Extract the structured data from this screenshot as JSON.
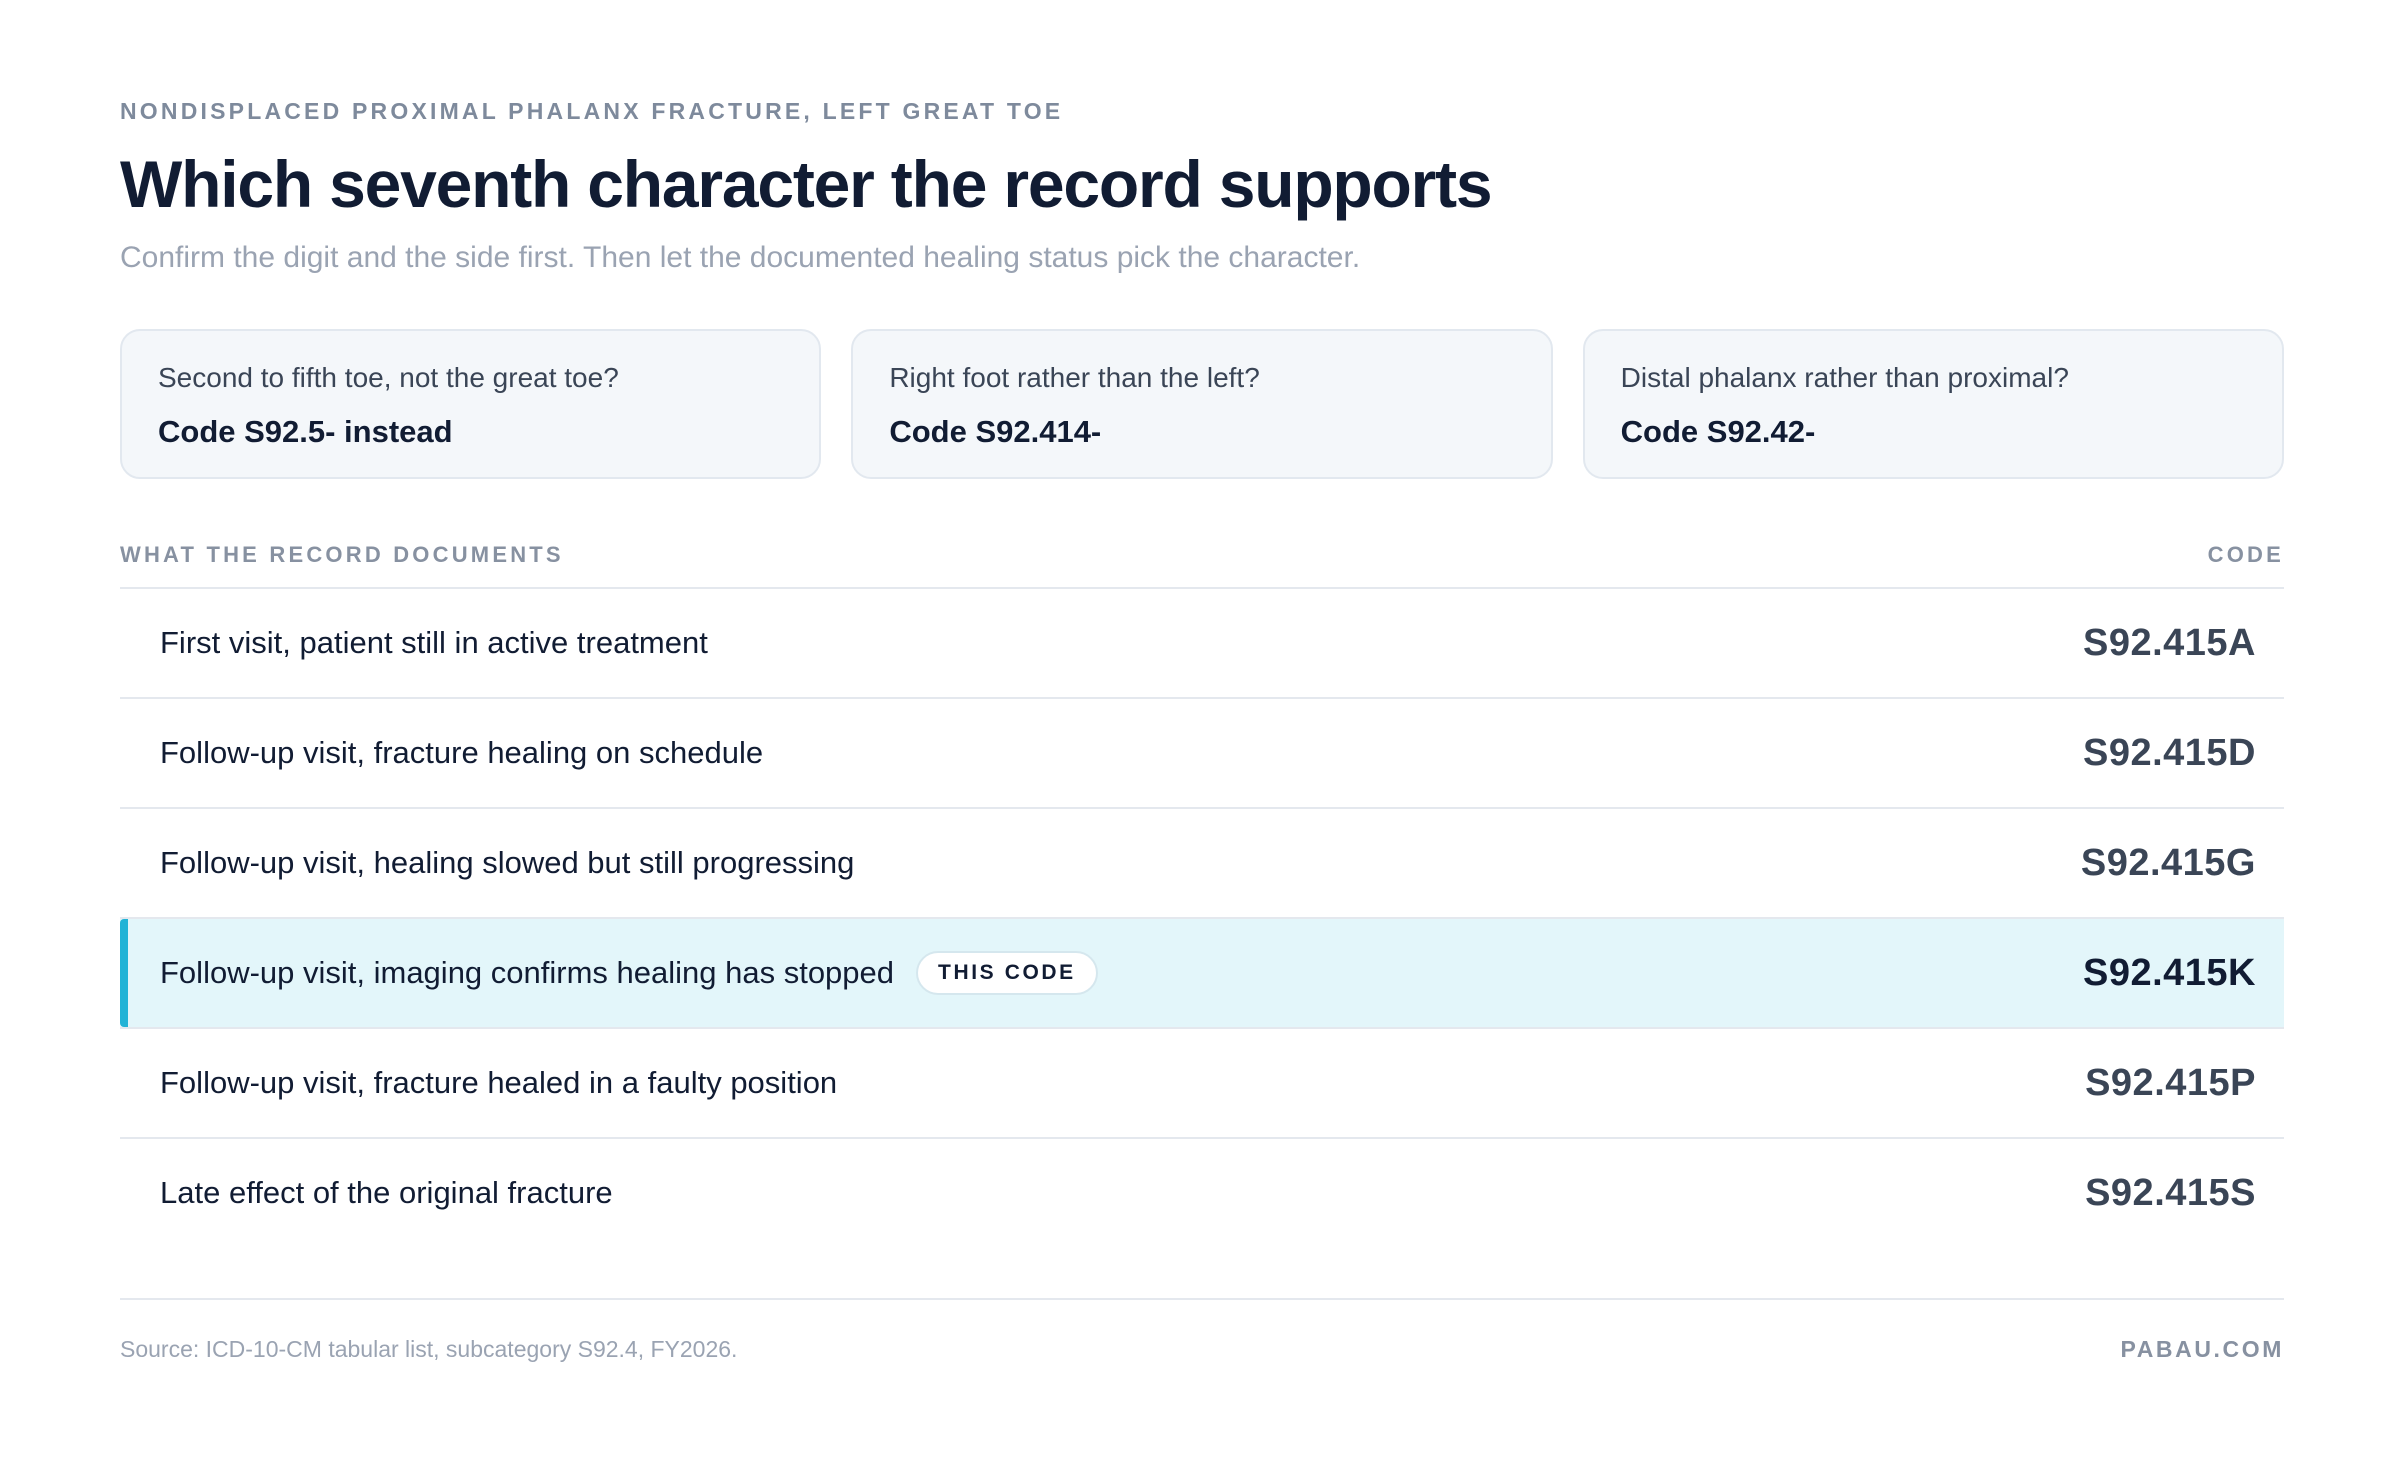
{
  "header": {
    "eyebrow": "NONDISPLACED PROXIMAL PHALANX FRACTURE, LEFT GREAT TOE",
    "title": "Which seventh character the record supports",
    "subtitle": "Confirm the digit and the side first. Then let the documented healing status pick the character."
  },
  "checks": [
    {
      "question": "Second to fifth toe, not the great toe?",
      "answer": "Code S92.5- instead"
    },
    {
      "question": "Right foot rather than the left?",
      "answer": "Code S92.414-"
    },
    {
      "question": "Distal phalanx rather than proximal?",
      "answer": "Code S92.42-"
    }
  ],
  "table": {
    "col_left": "WHAT THE RECORD DOCUMENTS",
    "col_right": "CODE",
    "rows": [
      {
        "label": "First visit, patient still in active treatment",
        "code": "S92.415A"
      },
      {
        "label": "Follow-up visit, fracture healing on schedule",
        "code": "S92.415D"
      },
      {
        "label": "Follow-up visit, healing slowed but still progressing",
        "code": "S92.415G"
      },
      {
        "label": "Follow-up visit, imaging confirms healing has stopped",
        "code": "S92.415K",
        "badge": "THIS CODE"
      },
      {
        "label": "Follow-up visit, fracture healed in a faulty position",
        "code": "S92.415P"
      },
      {
        "label": "Late effect of the original fracture",
        "code": "S92.415S"
      }
    ]
  },
  "footer": {
    "source": "Source: ICD-10-CM tabular list, subcategory S92.4, FY2026.",
    "brand": "PABAU.COM"
  },
  "colors": {
    "accent": "#22b3d6",
    "selected_row_bg": "#e3f6fa",
    "heading": "#111c33"
  }
}
